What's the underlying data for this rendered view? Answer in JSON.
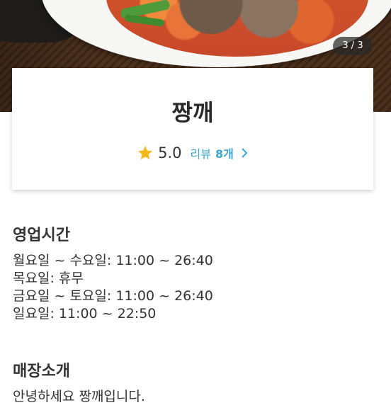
{
  "hero": {
    "image_counter": "3 / 3"
  },
  "store": {
    "name": "짱깨",
    "rating": "5.0",
    "review_label": "리뷰",
    "review_count": "8개",
    "star_icon": "star-icon",
    "chevron_icon": "chevron-right-icon",
    "accent_color": "#3aa7d6",
    "star_color": "#f5b71a"
  },
  "business_hours": {
    "title": "영업시간",
    "lines": [
      "월요일 ~ 수요일: 11:00 ~ 26:40",
      "목요일: 휴무",
      "금요일 ~ 토요일: 11:00 ~ 26:40",
      "일요일: 11:00 ~ 22:50"
    ]
  },
  "store_intro": {
    "title": "매장소개",
    "text": "안녕하세요 짱깨입니다."
  }
}
